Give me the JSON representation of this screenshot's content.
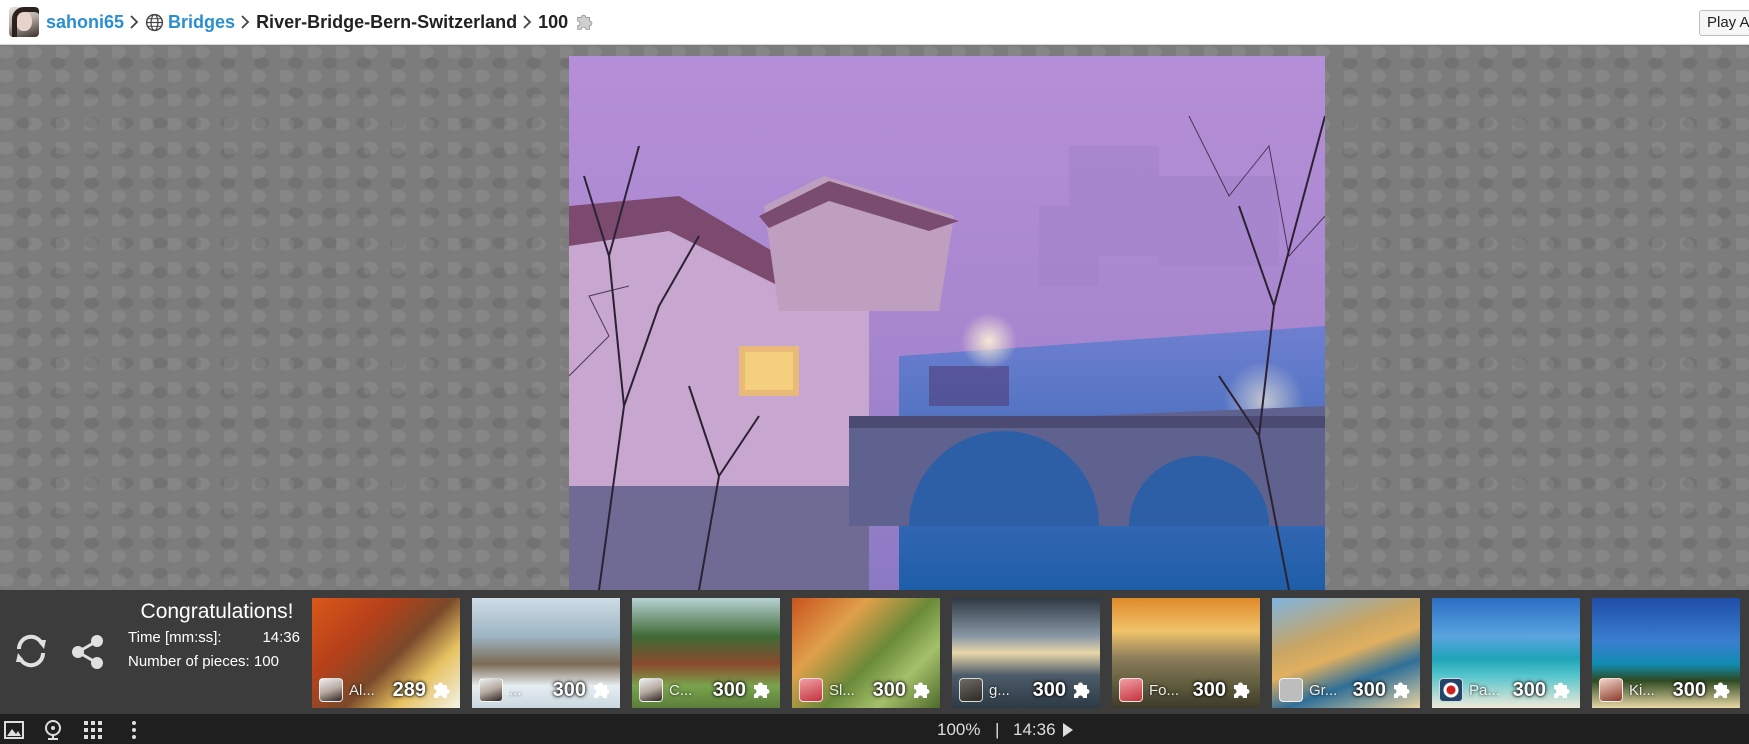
{
  "breadcrumb": {
    "user": "sahoni65",
    "category": "Bridges",
    "puzzle_name": "River-Bridge-Bern-Switzerland",
    "pieces": "100"
  },
  "top_button": {
    "label": "Play As"
  },
  "congrats": {
    "title": "Congratulations!",
    "time_label": "Time [mm:ss]:",
    "time_value": "14:36",
    "pieces_text": "Number of pieces: 100"
  },
  "thumbnails": [
    {
      "title": "Al...",
      "count": "289",
      "theme": "autumn-covered-bridge"
    },
    {
      "title": "...",
      "count": "300",
      "theme": "winter-barn"
    },
    {
      "title": "C...",
      "count": "300",
      "theme": "summer-barn"
    },
    {
      "title": "Sl...",
      "count": "300",
      "theme": "autumn-cottage"
    },
    {
      "title": "g...",
      "count": "300",
      "theme": "lake-castle"
    },
    {
      "title": "Fo...",
      "count": "300",
      "theme": "misty-field"
    },
    {
      "title": "Gr...",
      "count": "300",
      "theme": "coastal-cliffs"
    },
    {
      "title": "Pa...",
      "count": "300",
      "theme": "tropical-beach"
    },
    {
      "title": "Ki...",
      "count": "300",
      "theme": "palm-beach"
    }
  ],
  "footer": {
    "zoom": "100%",
    "separator": "|",
    "time": "14:36"
  },
  "colors": {
    "link": "#2a8fd1",
    "strip_bg": "#3c3c3c",
    "footer_bg": "#1f1f1f",
    "canvas_bg": "#7c7c7c"
  }
}
